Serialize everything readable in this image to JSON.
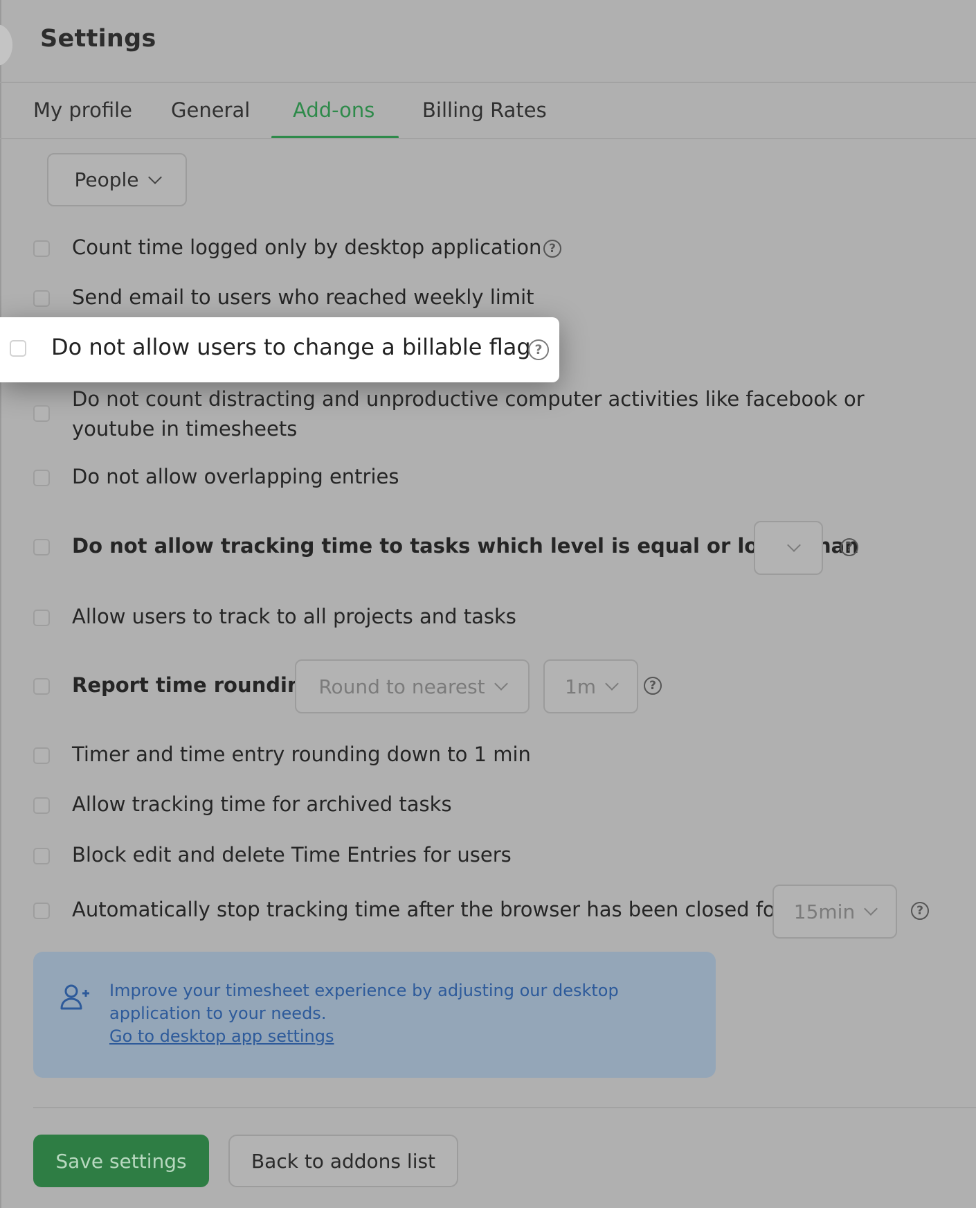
{
  "page": {
    "title": "Settings"
  },
  "tabs": [
    {
      "label": "My profile",
      "active": false
    },
    {
      "label": "General",
      "active": false
    },
    {
      "label": "Add-ons",
      "active": true
    },
    {
      "label": "Billing Rates",
      "active": false
    }
  ],
  "people_filter": {
    "value": "People"
  },
  "options": [
    {
      "label": "Count time logged only by desktop application",
      "checked": false,
      "has_help": true
    },
    {
      "label": "Send email to users who reached weekly limit",
      "checked": false
    },
    {
      "label": "Do not allow users to change a billable flag",
      "checked": false,
      "has_help": true,
      "highlighted": true
    },
    {
      "label": "Do not count distracting and unproductive computer activities like facebook or youtube in timesheets",
      "checked": false
    },
    {
      "label": "Do not allow overlapping entries",
      "checked": false
    },
    {
      "label": "Do not allow tracking time to tasks which level is equal or lower than",
      "checked": false,
      "has_help": true,
      "select_value": ""
    },
    {
      "label": "Allow users to track to all projects and tasks",
      "checked": false
    },
    {
      "label": "Report time rounding",
      "checked": false,
      "has_help": true,
      "rounding_mode": "Round to nearest",
      "rounding_unit": "1m"
    },
    {
      "label": "Timer and time entry rounding down to 1 min",
      "checked": false
    },
    {
      "label": "Allow tracking time for archived tasks",
      "checked": false
    },
    {
      "label": "Block edit and delete Time Entries for users",
      "checked": false
    },
    {
      "label": "Automatically stop tracking time after the browser has been closed for",
      "checked": false,
      "has_help": true,
      "select_value": "15min"
    }
  ],
  "info_box": {
    "icon": "add-user-icon",
    "text": "Improve your timesheet experience by adjusting our desktop application to your needs.",
    "link": "Go to desktop app settings"
  },
  "buttons": {
    "save": "Save settings",
    "back": "Back to addons list"
  },
  "colors": {
    "accent": "#2e8a4a",
    "info_text": "#2d5a9a",
    "info_bg": "#94a6b8",
    "overlay": "#b0b0b0"
  }
}
